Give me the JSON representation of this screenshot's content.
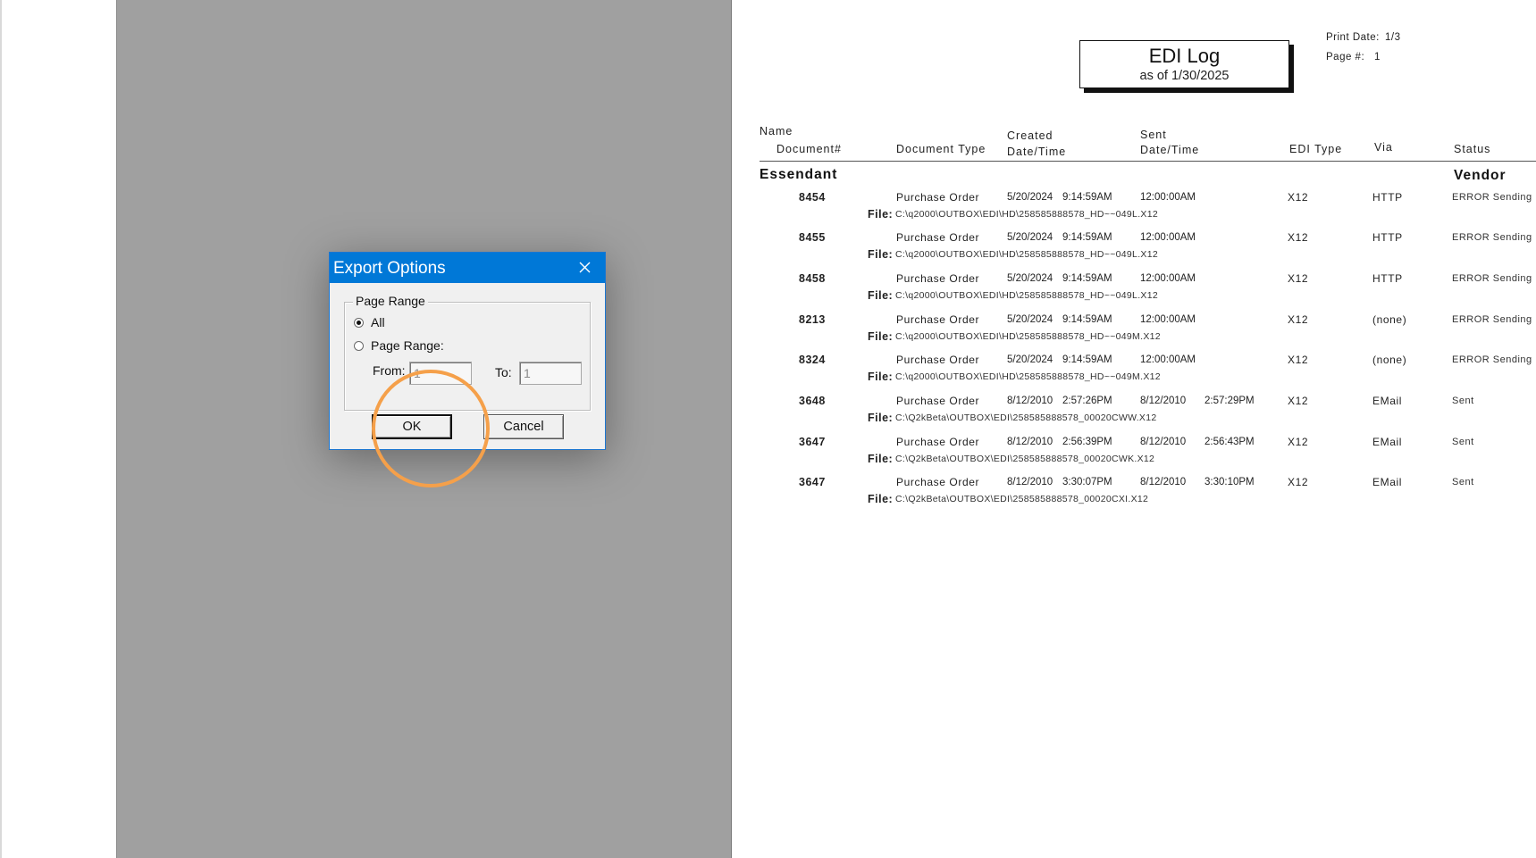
{
  "report": {
    "title": "EDI Log",
    "subtitle": "as of 1/30/2025",
    "print_date_label": "Print Date:",
    "print_date_value": "1/3",
    "page_label": "Page #:",
    "page_value": "1",
    "columns": {
      "name": "Name",
      "document": "Document#",
      "document_type": "Document Type",
      "created_1": "Created",
      "created_2": "Date/Time",
      "sent_1": "Sent",
      "sent_2": "Date/Time",
      "edi_type": "EDI Type",
      "via": "Via",
      "status": "Status"
    },
    "group": {
      "name": "Essendant",
      "type": "Vendor"
    },
    "file_label": "File:",
    "rows": [
      {
        "doc": "8454",
        "type": "Purchase Order",
        "created_date": "5/20/2024",
        "created_time": "9:14:59AM",
        "sent_date": "",
        "sent_time": "12:00:00AM",
        "edi": "X12",
        "via": "HTTP",
        "status": "ERROR Sending",
        "file": "C:\\q2000\\OUTBOX\\EDI\\HD\\258585888578_HD~~049L.X12"
      },
      {
        "doc": "8455",
        "type": "Purchase Order",
        "created_date": "5/20/2024",
        "created_time": "9:14:59AM",
        "sent_date": "",
        "sent_time": "12:00:00AM",
        "edi": "X12",
        "via": "HTTP",
        "status": "ERROR Sending",
        "file": "C:\\q2000\\OUTBOX\\EDI\\HD\\258585888578_HD~~049L.X12"
      },
      {
        "doc": "8458",
        "type": "Purchase Order",
        "created_date": "5/20/2024",
        "created_time": "9:14:59AM",
        "sent_date": "",
        "sent_time": "12:00:00AM",
        "edi": "X12",
        "via": "HTTP",
        "status": "ERROR Sending",
        "file": "C:\\q2000\\OUTBOX\\EDI\\HD\\258585888578_HD~~049L.X12"
      },
      {
        "doc": "8213",
        "type": "Purchase Order",
        "created_date": "5/20/2024",
        "created_time": "9:14:59AM",
        "sent_date": "",
        "sent_time": "12:00:00AM",
        "edi": "X12",
        "via": "(none)",
        "status": "ERROR Sending",
        "file": "C:\\q2000\\OUTBOX\\EDI\\HD\\258585888578_HD~~049M.X12"
      },
      {
        "doc": "8324",
        "type": "Purchase Order",
        "created_date": "5/20/2024",
        "created_time": "9:14:59AM",
        "sent_date": "",
        "sent_time": "12:00:00AM",
        "edi": "X12",
        "via": "(none)",
        "status": "ERROR Sending",
        "file": "C:\\q2000\\OUTBOX\\EDI\\HD\\258585888578_HD~~049M.X12"
      },
      {
        "doc": "3648",
        "type": "Purchase Order",
        "created_date": "8/12/2010",
        "created_time": "2:57:26PM",
        "sent_date": "8/12/2010",
        "sent_time": "2:57:29PM",
        "edi": "X12",
        "via": "EMail",
        "status": "Sent",
        "file": "C:\\Q2kBeta\\OUTBOX\\EDI\\258585888578_00020CWW.X12"
      },
      {
        "doc": "3647",
        "type": "Purchase Order",
        "created_date": "8/12/2010",
        "created_time": "2:56:39PM",
        "sent_date": "8/12/2010",
        "sent_time": "2:56:43PM",
        "edi": "X12",
        "via": "EMail",
        "status": "Sent",
        "file": "C:\\Q2kBeta\\OUTBOX\\EDI\\258585888578_00020CWK.X12"
      },
      {
        "doc": "3647",
        "type": "Purchase Order",
        "created_date": "8/12/2010",
        "created_time": "3:30:07PM",
        "sent_date": "8/12/2010",
        "sent_time": "3:30:10PM",
        "edi": "X12",
        "via": "EMail",
        "status": "Sent",
        "file": "C:\\Q2kBeta\\OUTBOX\\EDI\\258585888578_00020CXI.X12"
      }
    ]
  },
  "dialog": {
    "title": "Export Options",
    "close_icon": "close-icon",
    "group_label": "Page Range",
    "option_all": "All",
    "option_range": "Page Range:",
    "selected_option": "All",
    "from_label": "From:",
    "from_value": "1",
    "to_label": "To:",
    "to_value": "1",
    "ok_label": "OK",
    "cancel_label": "Cancel"
  },
  "colors": {
    "titlebar": "#0078d7",
    "dialog_bg": "#f0f0f0",
    "backdrop": "#a0a0a0",
    "highlight": "#f5a04a"
  }
}
